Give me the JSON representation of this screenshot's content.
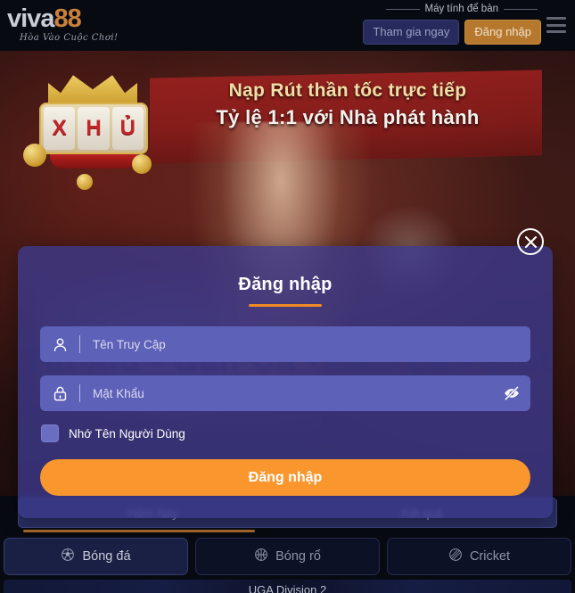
{
  "header": {
    "logo_main": "viva",
    "logo_accent": "88",
    "logo_tagline": "Hòa Vào Cuộc Chơi!",
    "desktop_label": "Máy tính để bàn",
    "join_label": "Tham gia ngay",
    "login_label": "Đăng nhập",
    "menu_icon": "hamburger-menu-icon",
    "join_bg": "#262a5c",
    "login_bg": "#b5782d"
  },
  "banner": {
    "line1": "Nạp Rút thần tốc trực tiếp",
    "line2": "Tỷ lệ 1:1 với Nhà phát hành",
    "slot_reels": [
      "X",
      "H",
      "Ủ"
    ],
    "background_text": "Tài Xỉu - Bắn Cá - Bắn Cá - Slot"
  },
  "modal": {
    "title": "Đăng nhập",
    "close_icon": "close-circle-icon",
    "accent_color": "#f08a24",
    "panel_color": "#3c3a8c",
    "username": {
      "icon": "user-icon",
      "placeholder": "Tên Truy Cập",
      "value": ""
    },
    "password": {
      "icon": "lock-icon",
      "placeholder": "Mật Khẩu",
      "value": "",
      "toggle_icon": "eye-slash-icon"
    },
    "remember_label": "Nhớ Tên Người Dùng",
    "remember_checked": false,
    "submit_label": "Đăng nhập",
    "submit_color": "#f9972e"
  },
  "bottom": {
    "tabs": [
      {
        "label": "Hôm Nay",
        "active": true
      },
      {
        "label": "Kết quả",
        "active": false
      }
    ],
    "sports": [
      {
        "label": "Bóng đá",
        "icon": "soccer-ball-icon",
        "active": true
      },
      {
        "label": "Bóng rổ",
        "icon": "basketball-icon",
        "active": false
      },
      {
        "label": "Cricket",
        "icon": "cricket-ball-icon",
        "active": false
      }
    ],
    "league": "UGA Division 2"
  }
}
